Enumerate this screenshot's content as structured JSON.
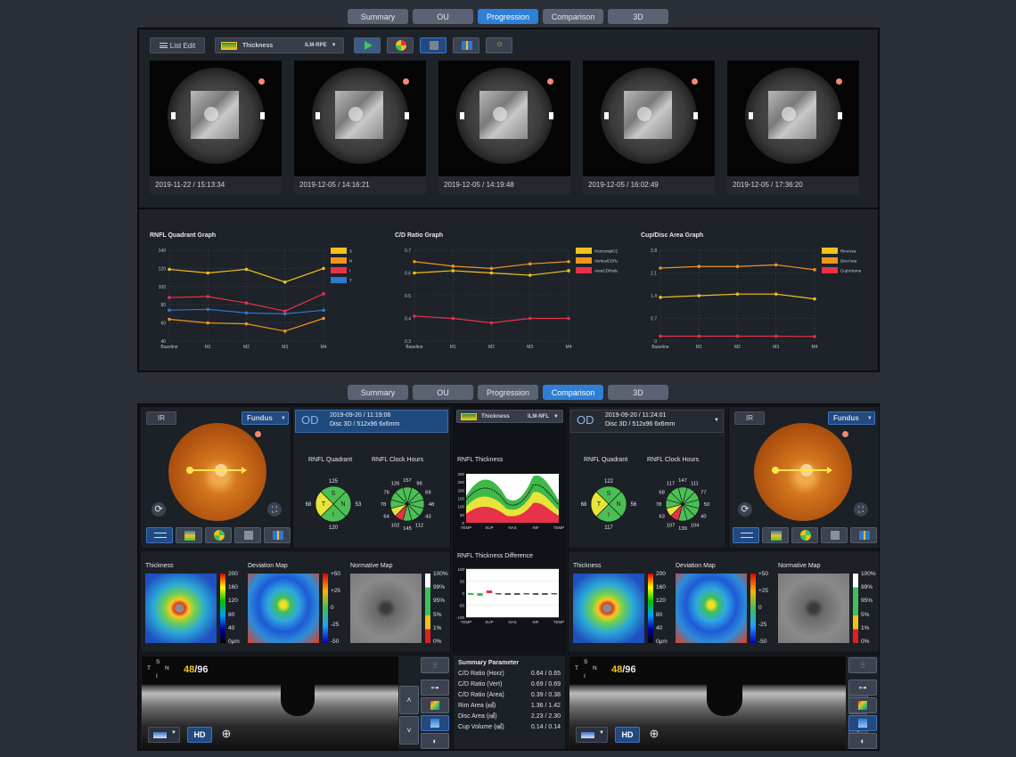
{
  "top_tabs": [
    "Summary",
    "OU",
    "Progression",
    "Comparison",
    "3D"
  ],
  "top_active": "Progression",
  "bottom_tabs": [
    "Summary",
    "OU",
    "Progression",
    "Comparison",
    "3D"
  ],
  "bottom_active": "Comparison",
  "progression": {
    "list_edit": "List Edit",
    "layer_label": "Thickness",
    "layer_value": "ILM-RPE",
    "tool_icons": [
      "play-icon",
      "deviation-icon",
      "fundus-icon",
      "chart-icon",
      "settings-icon"
    ],
    "scans": [
      {
        "date": "2019-11-22 / 15:13:34"
      },
      {
        "date": "2019-12-05 / 14:16:21"
      },
      {
        "date": "2019-12-05 / 14:19:48"
      },
      {
        "date": "2019-12-05 / 16:02:49"
      },
      {
        "date": "2019-12-05 / 17:36:20"
      }
    ]
  },
  "chart_data": [
    {
      "type": "line",
      "title": "RNFL Quadrant Graph",
      "categories": [
        "Baseline",
        "M1",
        "M2",
        "M3",
        "M4"
      ],
      "yticks": [
        "140",
        "120",
        "100",
        "80",
        "60",
        "40"
      ],
      "ylim": [
        40,
        140
      ],
      "series": [
        {
          "name": "S",
          "color": "#f2c21c",
          "values": [
            119,
            115,
            119,
            105,
            120
          ]
        },
        {
          "name": "N",
          "color": "#f0941c",
          "values": [
            64,
            60,
            59,
            51,
            65
          ]
        },
        {
          "name": "I",
          "color": "#e8314a",
          "values": [
            88,
            89,
            82,
            73,
            92
          ]
        },
        {
          "name": "T",
          "color": "#2e78d2",
          "values": [
            74,
            75,
            71,
            70,
            74
          ]
        }
      ]
    },
    {
      "type": "line",
      "title": "C/D Ratio Graph",
      "categories": [
        "Baseline",
        "M1",
        "M2",
        "M3",
        "M4"
      ],
      "yticks": [
        "0.7",
        "0.6",
        "0.5",
        "0.4",
        "0.3"
      ],
      "ylim": [
        0.3,
        0.7
      ],
      "series": [
        {
          "name": "HorizontalCDRatio",
          "color": "#f2c21c",
          "values": [
            0.6,
            0.61,
            0.6,
            0.59,
            0.61
          ]
        },
        {
          "name": "VerticalCDRatio",
          "color": "#f0941c",
          "values": [
            0.65,
            0.63,
            0.62,
            0.64,
            0.65
          ]
        },
        {
          "name": "AreaCDRatio",
          "color": "#e8314a",
          "values": [
            0.41,
            0.4,
            0.38,
            0.4,
            0.4
          ]
        }
      ]
    },
    {
      "type": "line",
      "title": "Cup/Disc Area Graph",
      "categories": [
        "Baseline",
        "M1",
        "M2",
        "M3",
        "M4"
      ],
      "yticks": [
        "2.8",
        "2.1",
        "1.4",
        "0.7",
        "0"
      ],
      "ylim": [
        0,
        2.8
      ],
      "series": [
        {
          "name": "RimArea",
          "color": "#f2c21c",
          "values": [
            1.35,
            1.4,
            1.45,
            1.45,
            1.3
          ]
        },
        {
          "name": "DiscArea",
          "color": "#f0941c",
          "values": [
            2.25,
            2.3,
            2.3,
            2.35,
            2.2
          ]
        },
        {
          "name": "CupVolume",
          "color": "#e8314a",
          "values": [
            0.15,
            0.15,
            0.15,
            0.15,
            0.14
          ]
        }
      ]
    }
  ],
  "left": {
    "ir": "IR",
    "fundus": "Fundus",
    "eye": "OD",
    "scan_date": "2019-09-20 / 11:19:06",
    "scan_desc": "Disc 3D / 512x96 6x6mm",
    "quadrant_title": "RNFL Quadrant",
    "clock_title": "RNFL Clock Hours",
    "quadrant": {
      "S": "125",
      "N": "53",
      "I": "120",
      "T": "68"
    },
    "quadrant_letters": [
      "S",
      "N",
      "I",
      "T"
    ],
    "clock": [
      "157",
      "98",
      "69",
      "48",
      "43",
      "112",
      "145",
      "102",
      "64",
      "78",
      "76",
      "126"
    ],
    "slice": "48",
    "slice_total": "/96"
  },
  "right": {
    "ir": "IR",
    "fundus": "Fundus",
    "eye": "OD",
    "scan_date": "2019-09-20 / 11:24:01",
    "scan_desc": "Disc 3D / 512x96 6x6mm",
    "quadrant_title": "RNFL Quadrant",
    "clock_title": "RNFL Clock Hours",
    "quadrant": {
      "S": "122",
      "N": "56",
      "I": "117",
      "T": "68"
    },
    "quadrant_letters": [
      "S",
      "N",
      "I",
      "T"
    ],
    "clock": [
      "147",
      "111",
      "77",
      "50",
      "40",
      "104",
      "139",
      "107",
      "63",
      "78",
      "68",
      "117"
    ],
    "slice": "48",
    "slice_total": "/96"
  },
  "maps": {
    "thickness": "Thickness",
    "deviation": "Deviation Map",
    "normative": "Normative Map",
    "thickness_scale": [
      "200",
      "160",
      "120",
      "80",
      "40",
      "0μm"
    ],
    "deviation_scale": [
      "+50",
      "+25",
      "0",
      "-25",
      "-50"
    ],
    "normative_scale": [
      "100%",
      "99%",
      "95%",
      "5%",
      "1%",
      "0%"
    ]
  },
  "center": {
    "layer_label": "Thickness",
    "layer_value": "ILM-NFL",
    "rnfl_title": "RNFL Thickness",
    "rnfl_diff_title": "RNFL Thickness Difference",
    "rnfl_yticks": [
      "300",
      "250",
      "200",
      "150",
      "100",
      "50",
      "0"
    ],
    "rnfl_xticks": [
      "TEMP",
      "SUP",
      "NAS",
      "INF",
      "TEMP"
    ],
    "diff_yticks": [
      "100",
      "50",
      "0",
      "-50",
      "-100"
    ],
    "summary_title": "Summary Parameter",
    "summary": [
      {
        "label": "C/D Ratio (Horz)",
        "value": "0.64 / 0.65"
      },
      {
        "label": "C/D Ratio (Vert)",
        "value": "0.69 / 0.69"
      },
      {
        "label": "C/D Ratio (Area)",
        "value": "0.39 / 0.38"
      },
      {
        "label": "Rim Area (㎟)",
        "value": "1.36 / 1.42"
      },
      {
        "label": "Disc Area (㎟)",
        "value": "2.23 / 2.30"
      },
      {
        "label": "Cup Volume (㎣)",
        "value": "0.14 / 0.14"
      }
    ]
  },
  "oct_controls": {
    "hd": "HD",
    "orient_s": "S",
    "orient_n": "N",
    "orient_i": "I",
    "orient_t": "T"
  },
  "colors": {
    "accent": "#2f7fd6",
    "panel": "#1e2229",
    "background": "#2a2e36"
  }
}
